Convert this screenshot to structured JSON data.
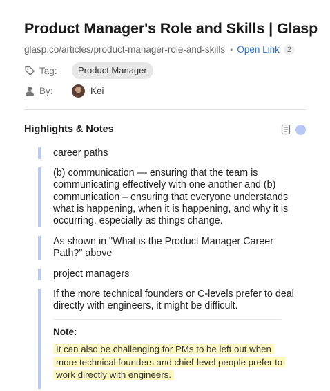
{
  "article": {
    "title": "Product Manager's Role and Skills | Glasp",
    "url": "glasp.co/articles/product-manager-role-and-skills",
    "separator": "•",
    "open_link_label": "Open Link",
    "open_link_count": "2"
  },
  "meta": {
    "tag_label": "Tag:",
    "tag": "Product Manager",
    "by_label": "By:",
    "author": "Kei"
  },
  "highlights_section": {
    "title": "Highlights & Notes",
    "accent_color": "#b6c8f5",
    "note_highlight_color": "#fdf8c0",
    "items": [
      {
        "lines": [
          "career paths"
        ]
      },
      {
        "lines": [
          "(b) communication — ensuring that the team is",
          "communicating effectively with one another and (b)",
          "communication – ensuring that everyone understands",
          "what is happening, when it is happening, and why it is",
          "occurring, especially as things change."
        ]
      },
      {
        "lines": [
          "As shown in \"What is the Product Manager Career",
          "Path?\" above"
        ]
      },
      {
        "lines": [
          "project managers"
        ]
      },
      {
        "lines": [
          "If the more technical founders or C-levels prefer to deal",
          "directly with engineers, it might be difficult."
        ],
        "note": {
          "label": "Note:",
          "lines": [
            "It can also be challenging for PMs to be left out when",
            "more technical founders and chief-level people prefer to",
            "work directly with engineers."
          ]
        }
      }
    ]
  },
  "icons": {
    "tag": "tag-icon",
    "person": "person-icon",
    "document": "document-icon"
  }
}
